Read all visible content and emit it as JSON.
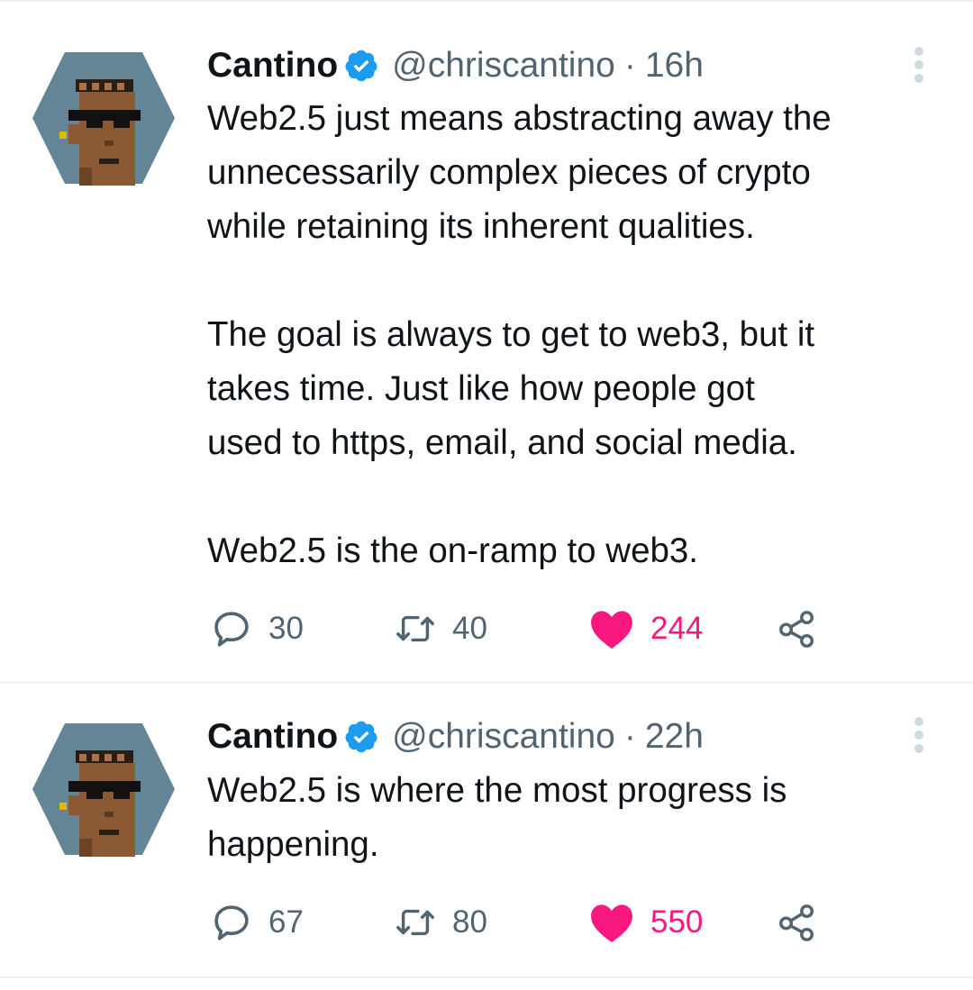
{
  "colors": {
    "text": "#0f1419",
    "secondary": "#536471",
    "verified": "#1d9bf0",
    "like": "#f91880",
    "avatar_bg": "#638596",
    "divider": "#eff3f4"
  },
  "icons": {
    "reply": "speech-bubble-icon",
    "retweet": "retweet-arrows-icon",
    "like": "filled-heart-icon",
    "share": "share-nodes-icon",
    "more": "vertical-ellipsis-icon",
    "verified": "verified-badge-icon"
  },
  "tweets": [
    {
      "author": "Cantino",
      "handle": "@chriscantino",
      "separator": "·",
      "time": "16h",
      "text": "Web2.5 just means abstracting away the\nunnecessarily complex pieces of crypto\nwhile retaining its inherent qualities.\n\nThe goal is always to get to web3, but it\ntakes time. Just like how people got\nused to https, email, and social media.\n\nWeb2.5 is the on-ramp to web3.",
      "replies": "30",
      "retweets": "40",
      "likes": "244",
      "liked": true
    },
    {
      "author": "Cantino",
      "handle": "@chriscantino",
      "separator": "·",
      "time": "22h",
      "text": "Web2.5 is where the most progress is\nhappening.",
      "replies": "67",
      "retweets": "80",
      "likes": "550",
      "liked": true
    }
  ]
}
